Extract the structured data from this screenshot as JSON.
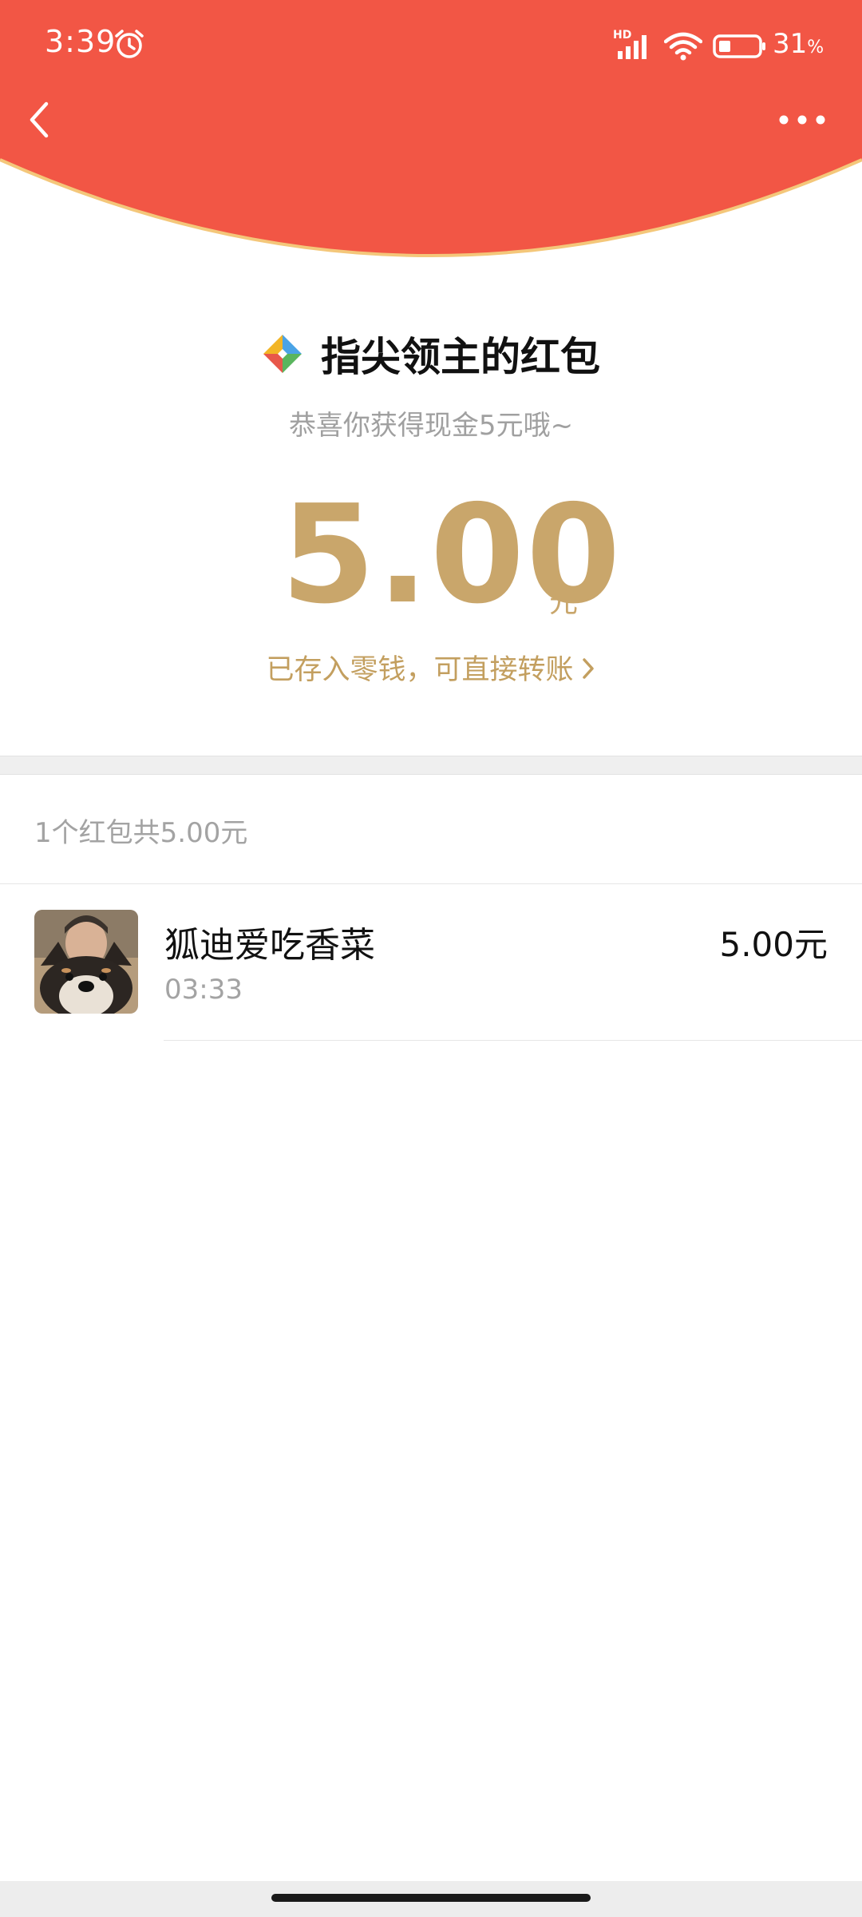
{
  "status_bar": {
    "time": "3:39",
    "hd_label": "HD",
    "battery_percent": "31",
    "battery_unit": "%"
  },
  "colors": {
    "header_red": "#f25645",
    "gold": "#c9a66b",
    "header_border": "#f4c77a"
  },
  "icons": {
    "back": "chevron-left-icon",
    "more": "more-dots-icon",
    "alarm": "alarm-icon",
    "signal": "signal-icon",
    "wifi": "wifi-icon",
    "battery": "battery-icon",
    "logo": "app-logo-icon"
  },
  "red_packet": {
    "sender": "指尖领主的红包",
    "greeting": "恭喜你获得现金5元哦~",
    "amount": "5.00",
    "unit": "元",
    "saved_note": "已存入零钱，可直接转账"
  },
  "summary": {
    "text": "1个红包共5.00元"
  },
  "records": [
    {
      "name": "狐迪爱吃香菜",
      "time": "03:33",
      "amount": "5.00元"
    }
  ]
}
